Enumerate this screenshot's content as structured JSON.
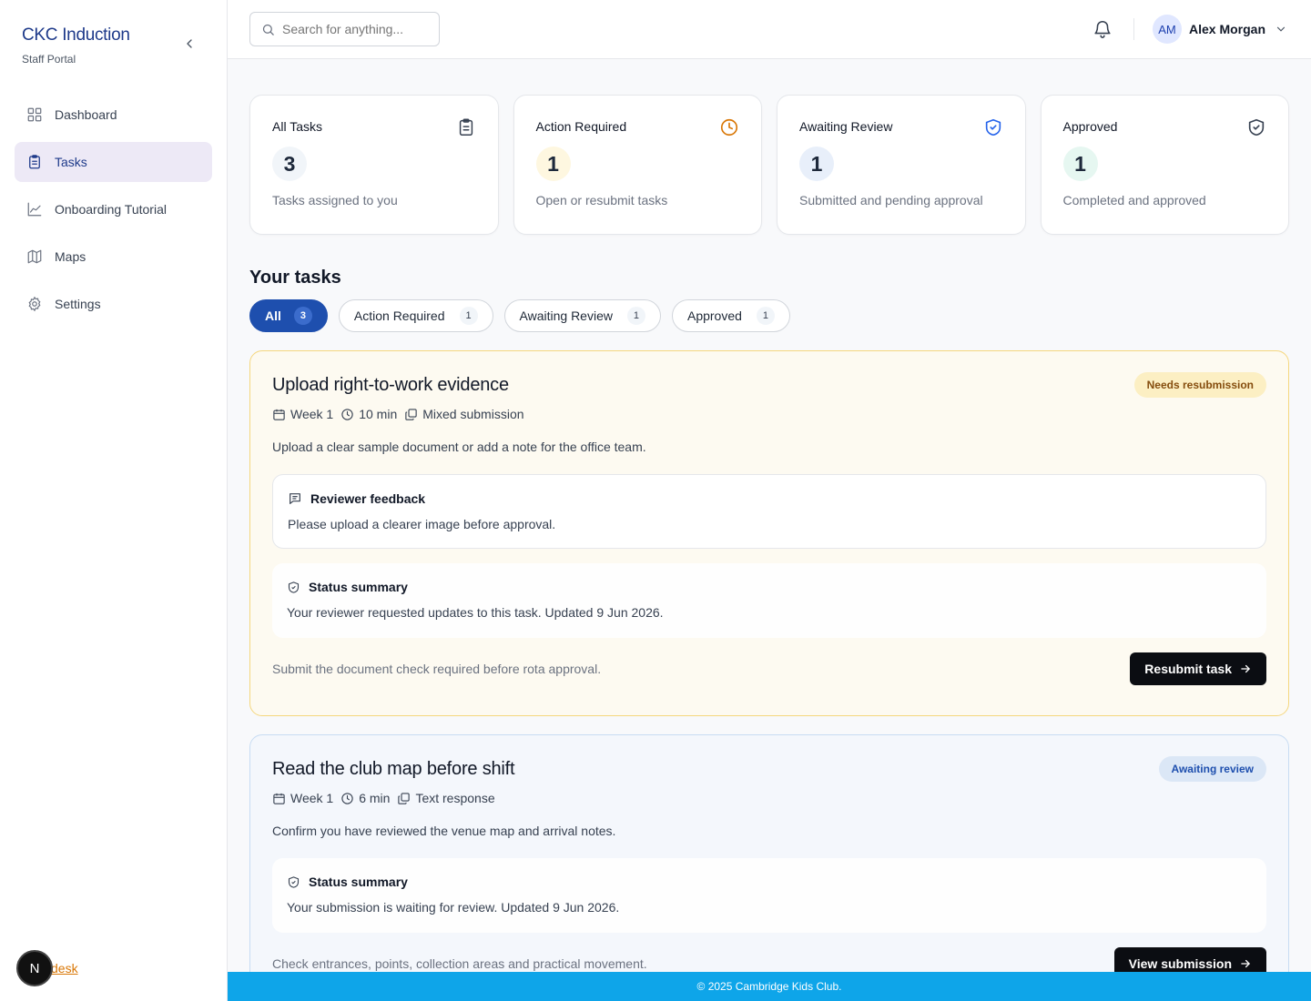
{
  "sidebar": {
    "brand_title": "CKC Induction",
    "brand_subtitle": "Staff Portal",
    "items": [
      {
        "label": "Dashboard",
        "icon": "grid-icon"
      },
      {
        "label": "Tasks",
        "icon": "clipboard-icon",
        "active": true
      },
      {
        "label": "Onboarding Tutorial",
        "icon": "chart-line-icon"
      },
      {
        "label": "Maps",
        "icon": "map-icon"
      },
      {
        "label": "Settings",
        "icon": "gear-icon"
      }
    ],
    "footer_badge": "N",
    "footer_link": "desk"
  },
  "topbar": {
    "search_placeholder": "Search for anything...",
    "user_initials": "AM",
    "user_name": "Alex Morgan"
  },
  "stats": [
    {
      "label": "All Tasks",
      "value": "3",
      "desc": "Tasks assigned to you",
      "icon": "clipboard-icon",
      "accent": "#f1f5f9"
    },
    {
      "label": "Action Required",
      "value": "1",
      "desc": "Open or resubmit tasks",
      "icon": "clock-icon",
      "accent": "#fef7e0"
    },
    {
      "label": "Awaiting Review",
      "value": "1",
      "desc": "Submitted and pending approval",
      "icon": "shield-icon",
      "accent": "#e8effa"
    },
    {
      "label": "Approved",
      "value": "1",
      "desc": "Completed and approved",
      "icon": "shield-check-icon",
      "accent": "#e6f7f1"
    }
  ],
  "section_title": "Your tasks",
  "filters": [
    {
      "label": "All",
      "count": "3",
      "active": true
    },
    {
      "label": "Action Required",
      "count": "1"
    },
    {
      "label": "Awaiting Review",
      "count": "1"
    },
    {
      "label": "Approved",
      "count": "1"
    }
  ],
  "tasks": [
    {
      "title": "Upload right-to-work evidence",
      "badge": "Needs resubmission",
      "week": "Week 1",
      "duration": "10 min",
      "type": "Mixed submission",
      "description": "Upload a clear sample document or add a note for the office team.",
      "feedback_title": "Reviewer feedback",
      "feedback_body": "Please upload a clearer image before approval.",
      "status_title": "Status summary",
      "status_body": "Your reviewer requested updates to this task. Updated 9 Jun 2026.",
      "footer_text": "Submit the document check required before rota approval.",
      "action": "Resubmit task"
    },
    {
      "title": "Read the club map before shift",
      "badge": "Awaiting review",
      "week": "Week 1",
      "duration": "6 min",
      "type": "Text response",
      "description": "Confirm you have reviewed the venue map and arrival notes.",
      "status_title": "Status summary",
      "status_body": "Your submission is waiting for review. Updated 9 Jun 2026.",
      "footer_text": "Check entrances, points, collection areas and practical movement.",
      "action": "View submission"
    }
  ],
  "footer": "© 2025 Cambridge Kids Club."
}
